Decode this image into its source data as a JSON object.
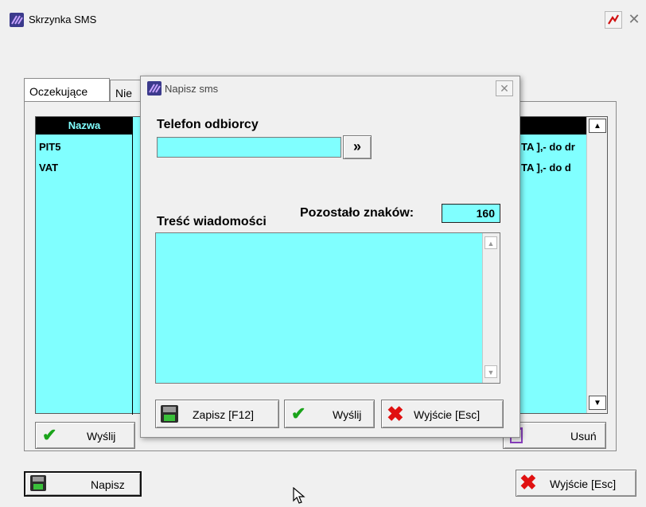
{
  "window": {
    "title": "Skrzynka SMS"
  },
  "tabs": [
    {
      "label": "Oczekujące"
    },
    {
      "label": "Nie"
    }
  ],
  "list": {
    "header": "Nazwa",
    "rows": [
      {
        "name": "PIT5",
        "tail": "TA ],- do dr"
      },
      {
        "name": "VAT",
        "tail": "TA ],- do d"
      }
    ]
  },
  "tab_buttons": {
    "send": "Wyślij",
    "delete": "Usuń"
  },
  "bottom_buttons": {
    "write": "Napisz",
    "exit": "Wyjście  [Esc]"
  },
  "dialog": {
    "title": "Napisz sms",
    "phone_label": "Telefon odbiorcy",
    "phone_value": "",
    "phone_picker": "»",
    "remaining_label": "Pozostało znaków:",
    "remaining_value": "160",
    "message_label": "Treść wiadomości",
    "message_value": "",
    "save": "Zapisz  [F12]",
    "send": "Wyślij",
    "exit": "Wyjście  [Esc]"
  },
  "colors": {
    "field_bg": "#80ffff",
    "header_bg": "#000000",
    "check": "#1aa31a",
    "cross": "#e01010"
  }
}
